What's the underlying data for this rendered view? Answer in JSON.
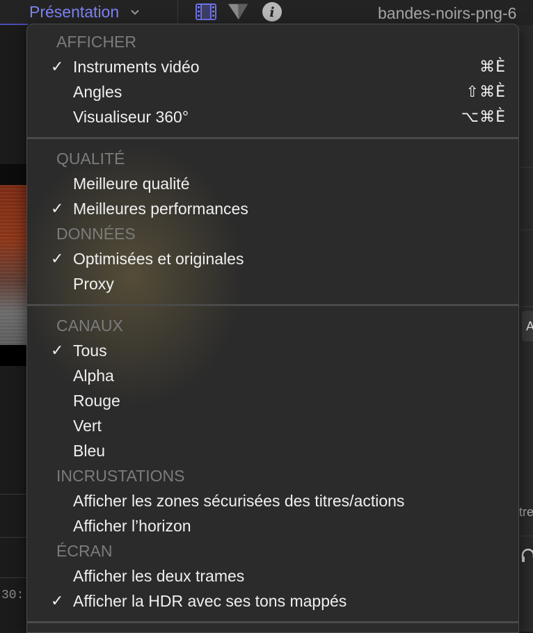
{
  "toolbar": {
    "presentation_label": "Présentation",
    "filename": "bandes-noirs-png-6"
  },
  "background": {
    "timecode": "30:",
    "right_button": "A",
    "right_text": "tre"
  },
  "menu": {
    "afficher": {
      "title": "AFFICHER",
      "items": [
        {
          "label": "Instruments vidéo",
          "checked": "✓",
          "shortcut": "⌘È"
        },
        {
          "label": "Angles",
          "checked": "",
          "shortcut": "⇧⌘È"
        },
        {
          "label": "Visualiseur 360°",
          "checked": "",
          "shortcut": "⌥⌘È"
        }
      ]
    },
    "qualite": {
      "title": "QUALITÉ",
      "items": [
        {
          "label": "Meilleure qualité",
          "checked": ""
        },
        {
          "label": "Meilleures performances",
          "checked": "✓"
        }
      ]
    },
    "donnees": {
      "title": "DONNÉES",
      "items": [
        {
          "label": "Optimisées et originales",
          "checked": "✓"
        },
        {
          "label": "Proxy",
          "checked": ""
        }
      ]
    },
    "canaux": {
      "title": "CANAUX",
      "items": [
        {
          "label": "Tous",
          "checked": "✓"
        },
        {
          "label": "Alpha",
          "checked": ""
        },
        {
          "label": "Rouge",
          "checked": ""
        },
        {
          "label": "Vert",
          "checked": ""
        },
        {
          "label": "Bleu",
          "checked": ""
        }
      ]
    },
    "incrustations": {
      "title": "INCRUSTATIONS",
      "items": [
        {
          "label": "Afficher les zones sécurisées des titres/actions",
          "checked": ""
        },
        {
          "label": "Afficher l’horizon",
          "checked": ""
        }
      ]
    },
    "ecran": {
      "title": "ÉCRAN",
      "items": [
        {
          "label": "Afficher les deux trames",
          "checked": ""
        },
        {
          "label": "Afficher la HDR avec ses tons mappés",
          "checked": "✓"
        }
      ]
    }
  },
  "colors": {
    "accent": "#7e82f5",
    "menu_bg": "#2b2b2b",
    "section_title": "#7c7c7c"
  }
}
